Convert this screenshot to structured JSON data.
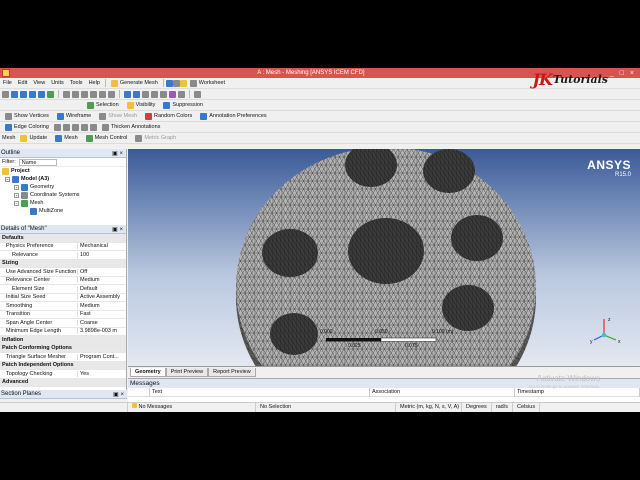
{
  "window": {
    "title": "A : Mesh - Meshing [ANSYS ICEM CFD]",
    "controls": [
      "_",
      "□",
      "×"
    ]
  },
  "brand": {
    "jk": "JK",
    "tutorials": "Tutorials"
  },
  "menu": [
    "File",
    "Edit",
    "View",
    "Units",
    "Tools",
    "Help"
  ],
  "toolbar1": {
    "generate_mesh": "Generate Mesh",
    "worksheet": "Worksheet"
  },
  "toolbar2": {
    "selection": "Selection",
    "visibility": "Visibility",
    "suppression": "Suppression"
  },
  "toolbar3": {
    "show_vertices": "Show Vertices",
    "wireframe": "Wireframe",
    "show_mesh": "Show Mesh",
    "random_colors": "Random Colors",
    "annotation_preferences": "Annotation Preferences"
  },
  "toolbar4": {
    "edge_coloring": "Edge Coloring",
    "thicken_annotations": "Thicken Annotations"
  },
  "toolbar5": {
    "mesh_label": "Mesh",
    "update": "Update",
    "mesh": "Mesh",
    "mesh_control": "Mesh Control",
    "metric_graph": "Metric Graph"
  },
  "outline": {
    "header": "Outline",
    "filter_label": "Filter:",
    "filter_value": "Name",
    "tree": [
      {
        "label": "Project",
        "bold": true
      },
      {
        "label": "Model (A3)",
        "bold": true
      },
      {
        "label": "Geometry"
      },
      {
        "label": "Coordinate Systems"
      },
      {
        "label": "Mesh"
      },
      {
        "label": "MultiZone"
      }
    ]
  },
  "details": {
    "header": "Details of \"Mesh\"",
    "rows": [
      {
        "type": "sec",
        "k": "Defaults"
      },
      {
        "k": "Physics Preference",
        "v": "Mechanical"
      },
      {
        "type": "sub",
        "k": "Relevance",
        "v": "100"
      },
      {
        "type": "sec",
        "k": "Sizing"
      },
      {
        "k": "Use Advanced Size Function",
        "v": "Off"
      },
      {
        "k": "Relevance Center",
        "v": "Medium"
      },
      {
        "type": "sub",
        "k": "Element Size",
        "v": "Default"
      },
      {
        "k": "Initial Size Seed",
        "v": "Active Assembly"
      },
      {
        "k": "Smoothing",
        "v": "Medium"
      },
      {
        "k": "Transition",
        "v": "Fast"
      },
      {
        "k": "Span Angle Center",
        "v": "Coarse"
      },
      {
        "k": "Minimum Edge Length",
        "v": "3.9898e-003 m"
      },
      {
        "type": "sec",
        "k": "Inflation"
      },
      {
        "type": "sec",
        "k": "Patch Conforming Options"
      },
      {
        "k": "Triangle Surface Mesher",
        "v": "Program Cont..."
      },
      {
        "type": "sec",
        "k": "Patch Independent Options"
      },
      {
        "k": "Topology Checking",
        "v": "Yes"
      },
      {
        "type": "sec",
        "k": "Advanced"
      }
    ]
  },
  "section_planes": {
    "header": "Section Planes"
  },
  "viewport": {
    "logo": "ANSYS",
    "release": "R15.0",
    "scale": [
      "0.000",
      "0.050",
      "0.100 (m)",
      "0.025",
      "0.075"
    ]
  },
  "view_tabs": [
    "Geometry",
    "Print Preview",
    "Report Preview"
  ],
  "messages": {
    "header": "Messages",
    "columns": [
      "Text",
      "Association",
      "Timestamp"
    ]
  },
  "watermark": {
    "line1": "Activate Windows",
    "line2": "Go to Settings to activate Windows."
  },
  "status": {
    "messages": "No Messages",
    "selection": "No Selection",
    "units": "Metric (m, kg, N, s, V, A)",
    "angle": "Degrees",
    "rate": "rad/s",
    "temp": "Celsius"
  },
  "colors": {
    "titlebar": "#d9534f",
    "viewport_top": "#3a5a98",
    "mesh_face": "#b4b4b4",
    "brand_red": "#d21414"
  }
}
